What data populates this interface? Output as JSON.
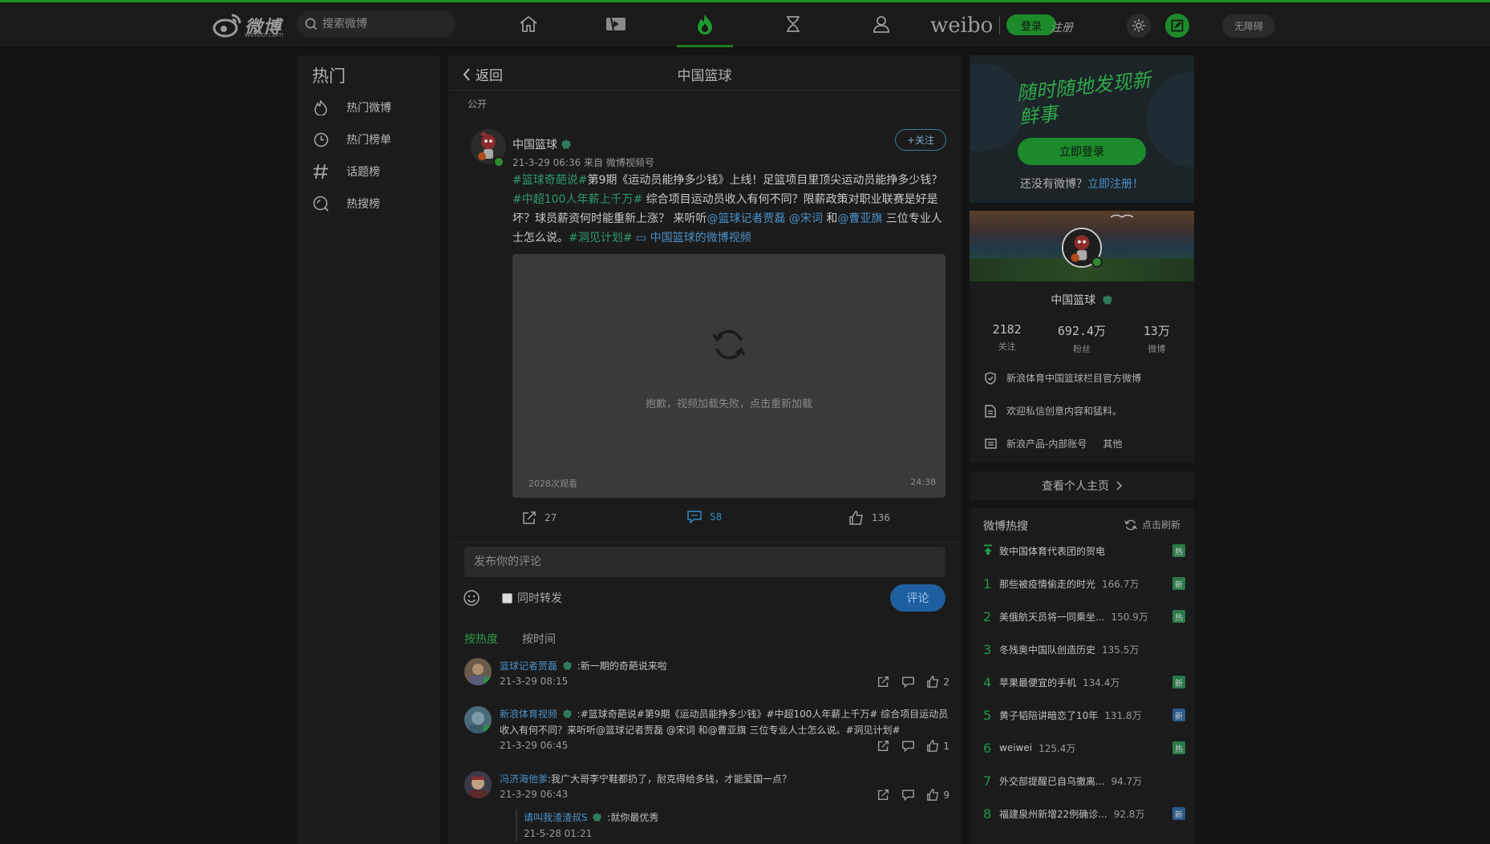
{
  "topbar": {
    "logo_text": "微博",
    "logo_sub": "weibo.com",
    "search_placeholder": "搜索微博",
    "brand_main": "weibo",
    "brand_cn": "微博",
    "login_label": "登录",
    "register_label": "注册",
    "access_label": "无障碍",
    "accent": "#1e8f1e"
  },
  "sidebar": {
    "title": "热门",
    "items": [
      {
        "label": "热门微博",
        "icon": "flame-icon"
      },
      {
        "label": "热门榜单",
        "icon": "clock-icon"
      },
      {
        "label": "话题榜",
        "icon": "hashtag-icon"
      },
      {
        "label": "热搜榜",
        "icon": "search-icon"
      }
    ]
  },
  "main": {
    "back_label": "返回",
    "title": "中国篮球",
    "visibility": "公开",
    "post": {
      "author": "中国篮球",
      "follow_label": "+关注",
      "meta": "21-3-29 06:36 来自 微博视频号",
      "segments": [
        {
          "type": "tag",
          "text": "#篮球奇葩说#"
        },
        {
          "type": "text",
          "text": "第9期《运动员能挣多少钱》上线！足篮项目里顶尖运动员能挣多少钱？"
        },
        {
          "type": "tag",
          "text": "#中超100人年薪上千万#"
        },
        {
          "type": "text",
          "text": " 综合项目运动员收入有何不同？限薪政策对职业联赛是好是坏？球员薪资何时能重新上涨？ 来听听"
        },
        {
          "type": "mention",
          "text": "@篮球记者贾磊"
        },
        {
          "type": "text",
          "text": " "
        },
        {
          "type": "mention",
          "text": "@宋词"
        },
        {
          "type": "text",
          "text": " 和"
        },
        {
          "type": "mention",
          "text": "@曹亚旗"
        },
        {
          "type": "text",
          "text": " 三位专业人士怎么说。"
        },
        {
          "type": "tag",
          "text": "#洞见计划#"
        },
        {
          "type": "text",
          "text": " "
        },
        {
          "type": "mention",
          "text": "▭ 中国篮球的微博视频"
        }
      ],
      "video": {
        "message": "抱歉，视频加载失败，点击重新加载",
        "views": "2028次观看",
        "duration": "24:38"
      },
      "reposts": "27",
      "comments": "58",
      "likes": "136"
    },
    "comment_placeholder": "发布你的评论",
    "repost_also_label": "同时转发",
    "submit_label": "评论",
    "sort_hot": "按热度",
    "sort_time": "按时间",
    "comments": [
      {
        "user": "篮球记者贾磊",
        "text": ":新一期的奇葩说来啦",
        "time": "21-3-29 08:15",
        "likes": "2"
      },
      {
        "user": "新浪体育视频",
        "text": ":#篮球奇葩说#第9期《运动员能挣多少钱》#中超100人年薪上千万# 综合项目运动员收入有何不同？来听听@篮球记者贾磊 @宋词 和@曹亚旗 三位专业人士怎么说。#洞见计划#",
        "time": "21-3-29 06:45",
        "likes": "1"
      },
      {
        "user": "冯济海他爹",
        "text": ":我广大哥李宁鞋都扔了，耐克得给多钱，才能爱国一点？",
        "time": "21-3-29 06:43",
        "likes": "9",
        "reply": {
          "user": "请叫我渣渣叔S",
          "text": ":就你最优秀",
          "time": "21-5-28 01:21"
        }
      }
    ]
  },
  "right": {
    "promo": {
      "slogan": "随时随地发现新鲜事",
      "login_label": "立即登录",
      "no_account": "还没有微博？",
      "register_link": "立即注册！"
    },
    "profile": {
      "name": "中国篮球",
      "stats": [
        {
          "value": "2182",
          "label": "关注"
        },
        {
          "value": "692.4万",
          "label": "粉丝"
        },
        {
          "value": "13万",
          "label": "微博"
        }
      ],
      "lines": [
        {
          "text": "新浪体育中国篮球栏目官方微博",
          "icon": "shield-icon"
        },
        {
          "text": "欢迎私信创意内容和猛料。",
          "icon": "document-icon"
        },
        {
          "text": "新浪产品-内部账号",
          "extra": "其他",
          "icon": "id-card-icon"
        }
      ]
    },
    "view_home_label": "查看个人主页",
    "hot": {
      "title": "微博热搜",
      "refresh_label": "点击刷新",
      "items": [
        {
          "rank": "top",
          "text": "致中国体育代表团的贺电",
          "count": "",
          "badge": "热",
          "badge_color": "#2a7a4a"
        },
        {
          "rank": "1",
          "text": "那些被疫情偷走的时光",
          "count": "166.7万",
          "badge": "新",
          "badge_color": "#2a7a4a"
        },
        {
          "rank": "2",
          "text": "美俄航天员将一同乘坐...",
          "count": "150.9万",
          "badge": "热",
          "badge_color": "#2a7a4a"
        },
        {
          "rank": "3",
          "text": "冬残奥中国队创造历史",
          "count": "135.5万",
          "badge": "",
          "badge_color": ""
        },
        {
          "rank": "4",
          "text": "苹果最便宜的手机",
          "count": "134.4万",
          "badge": "新",
          "badge_color": "#2a7a4a"
        },
        {
          "rank": "5",
          "text": "黄子韬陪讲暗恋了10年",
          "count": "131.8万",
          "badge": "新",
          "badge_color": "#2a5a8a"
        },
        {
          "rank": "6",
          "text": "weiwei",
          "count": "125.4万",
          "badge": "热",
          "badge_color": "#2a7a4a"
        },
        {
          "rank": "7",
          "text": "外交部提醒已自乌撤离...",
          "count": "94.7万",
          "badge": "",
          "badge_color": ""
        },
        {
          "rank": "8",
          "text": "福建泉州新增22例确诊...",
          "count": "92.8万",
          "badge": "新",
          "badge_color": "#2a5a8a"
        }
      ]
    }
  }
}
